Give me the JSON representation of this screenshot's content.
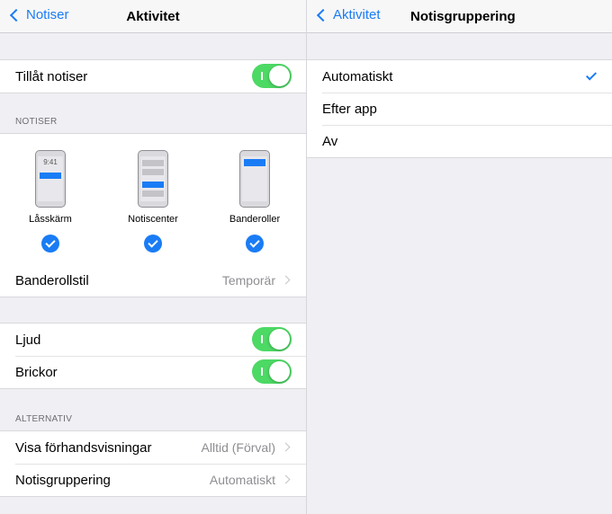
{
  "left": {
    "nav": {
      "back_label": "Notiser",
      "title": "Aktivitet"
    },
    "allow_notifications": {
      "label": "Tillåt notiser",
      "on": true
    },
    "notiser_header": "NOTISER",
    "alert_styles": [
      {
        "label": "Låsskärm",
        "clock": "9:41",
        "selected": true
      },
      {
        "label": "Notiscenter",
        "selected": true
      },
      {
        "label": "Banderoller",
        "selected": true
      }
    ],
    "banner_style": {
      "label": "Banderollstil",
      "value": "Temporär"
    },
    "sounds": {
      "label": "Ljud",
      "on": true
    },
    "badges": {
      "label": "Brickor",
      "on": true
    },
    "alternativ_header": "ALTERNATIV",
    "show_previews": {
      "label": "Visa förhandsvisningar",
      "value": "Alltid (Förval)"
    },
    "grouping": {
      "label": "Notisgruppering",
      "value": "Automatiskt"
    }
  },
  "right": {
    "nav": {
      "back_label": "Aktivitet",
      "title": "Notisgruppering"
    },
    "options": [
      {
        "label": "Automatiskt",
        "selected": true
      },
      {
        "label": "Efter app",
        "selected": false
      },
      {
        "label": "Av",
        "selected": false
      }
    ]
  },
  "colors": {
    "accent": "#1a7cf5",
    "toggle_on": "#4cd964",
    "background": "#efeff4"
  }
}
